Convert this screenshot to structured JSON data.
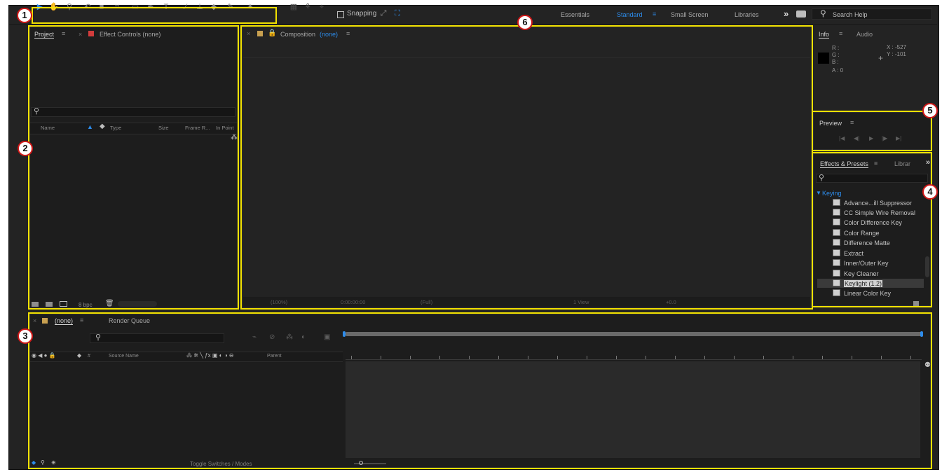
{
  "toolbar": {
    "snapping_label": "Snapping",
    "workspaces": [
      "Essentials",
      "Standard",
      "Small Screen",
      "Libraries"
    ],
    "active_workspace": "Standard",
    "overflow": "»",
    "search_placeholder": "Search Help"
  },
  "project_panel": {
    "tab_project": "Project",
    "tab_effect_controls": "Effect Controls (none)",
    "columns": [
      "Name",
      "Type",
      "Size",
      "Frame R...",
      "In Point"
    ],
    "bpc_label": "8 bpc"
  },
  "composition_panel": {
    "tab_label": "Composition",
    "comp_name": "(none)",
    "footer": [
      "(100%)",
      "0:00:00:00",
      "(Full)",
      "1 View",
      "+0.0"
    ]
  },
  "info_panel": {
    "tab_info": "Info",
    "tab_audio": "Audio",
    "r_label": "R :",
    "g_label": "G :",
    "b_label": "B :",
    "a_label": "A : 0",
    "x_readout": "X : -527",
    "y_readout": "Y : -101"
  },
  "preview_panel": {
    "title": "Preview"
  },
  "effects_panel": {
    "tab_effects": "Effects & Presets",
    "tab_library": "Librar",
    "category": "Keying",
    "items": [
      "Advance...ill Suppressor",
      "CC Simple Wire Removal",
      "Color Difference Key",
      "Color Range",
      "Difference Matte",
      "Extract",
      "Inner/Outer Key",
      "Key Cleaner",
      "Keylight (1.2)",
      "Linear Color Key"
    ],
    "selected_item": "Keylight (1.2)"
  },
  "timeline_panel": {
    "tab_comp": "(none)",
    "tab_render": "Render Queue",
    "col_source": "Source Name",
    "col_parent": "Parent",
    "col_hash": "#",
    "toggle_label": "Toggle Switches / Modes"
  },
  "markers": [
    "1",
    "2",
    "3",
    "4",
    "5",
    "6"
  ],
  "colors": {
    "highlight": "#f2e200",
    "accent": "#2d8ceb",
    "marker_ring": "#d01818",
    "comp_swatch": "#c8a050",
    "effect_swatch": "#d23c3c"
  }
}
